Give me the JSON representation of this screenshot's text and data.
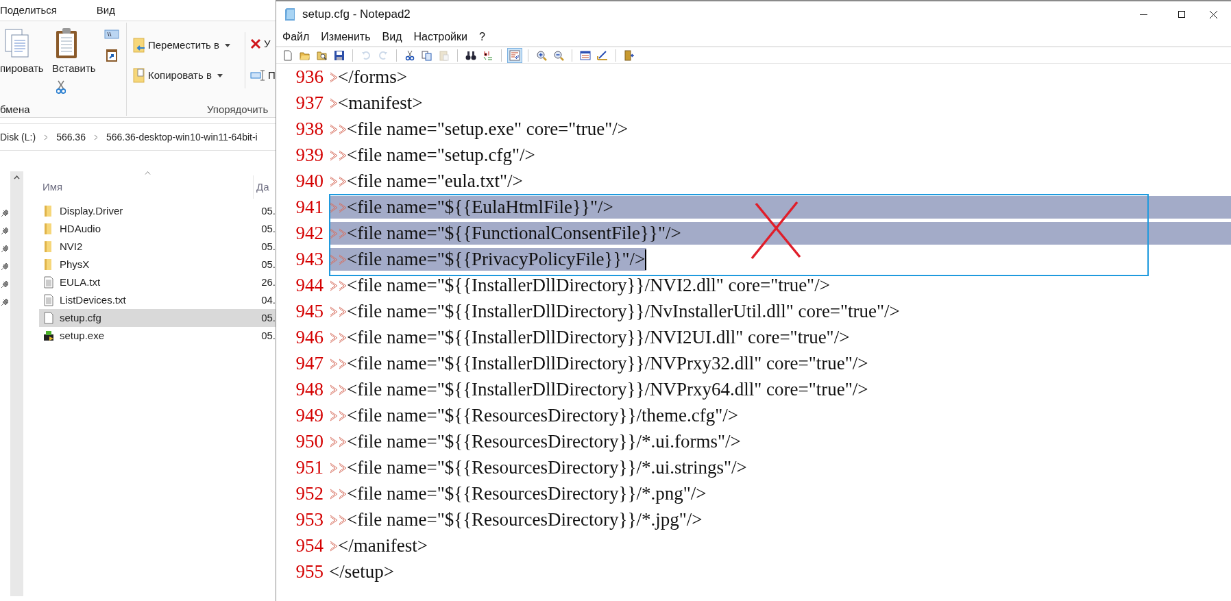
{
  "explorer": {
    "ribbon_tabs": [
      {
        "label": "Поделиться"
      },
      {
        "label": "Вид"
      }
    ],
    "clipboard": {
      "copy_label": "пировать",
      "paste_label": "Вставить",
      "group_label": "бмена"
    },
    "organize": {
      "move_label": "Переместить в",
      "copy_to_label": "Копировать в",
      "delete_label": "У",
      "rename_label": "П",
      "group_label": "Упорядочить"
    },
    "path": [
      "Disk (L:)",
      "566.36",
      "566.36-desktop-win10-win11-64bit-i"
    ],
    "columns": [
      "Имя",
      "Да"
    ],
    "files": [
      {
        "kind": "folder",
        "name": "Display.Driver",
        "date": "05.",
        "selected": false
      },
      {
        "kind": "folder",
        "name": "HDAudio",
        "date": "05.",
        "selected": false
      },
      {
        "kind": "folder",
        "name": "NVI2",
        "date": "05.",
        "selected": false
      },
      {
        "kind": "folder",
        "name": "PhysX",
        "date": "05.",
        "selected": false
      },
      {
        "kind": "text",
        "name": "EULA.txt",
        "date": "26.",
        "selected": false
      },
      {
        "kind": "text",
        "name": "ListDevices.txt",
        "date": "04.",
        "selected": false
      },
      {
        "kind": "blank",
        "name": "setup.cfg",
        "date": "05.",
        "selected": true
      },
      {
        "kind": "exe",
        "name": "setup.exe",
        "date": "05.",
        "selected": false
      }
    ]
  },
  "notepad": {
    "title": "setup.cfg - Notepad2",
    "menu": [
      "Файл",
      "Изменить",
      "Вид",
      "Настройки",
      "?"
    ],
    "toolbar": [
      {
        "kind": "new",
        "pressed": false,
        "disabled": false
      },
      {
        "kind": "open",
        "pressed": false,
        "disabled": false
      },
      {
        "kind": "browse",
        "pressed": false,
        "disabled": false
      },
      {
        "kind": "save",
        "pressed": false,
        "disabled": false
      },
      {
        "kind": "sep"
      },
      {
        "kind": "undo",
        "pressed": false,
        "disabled": true
      },
      {
        "kind": "redo",
        "pressed": false,
        "disabled": true
      },
      {
        "kind": "sep"
      },
      {
        "kind": "cut",
        "pressed": false,
        "disabled": false
      },
      {
        "kind": "copy",
        "pressed": false,
        "disabled": false
      },
      {
        "kind": "paste",
        "pressed": false,
        "disabled": true
      },
      {
        "kind": "sep"
      },
      {
        "kind": "find",
        "pressed": false,
        "disabled": false
      },
      {
        "kind": "replace",
        "pressed": false,
        "disabled": false
      },
      {
        "kind": "sep"
      },
      {
        "kind": "wrap",
        "pressed": true,
        "disabled": false
      },
      {
        "kind": "sep"
      },
      {
        "kind": "zoomin",
        "pressed": false,
        "disabled": false
      },
      {
        "kind": "zoomout",
        "pressed": false,
        "disabled": false
      },
      {
        "kind": "sep"
      },
      {
        "kind": "scheme",
        "pressed": false,
        "disabled": false
      },
      {
        "kind": "customize",
        "pressed": false,
        "disabled": false
      },
      {
        "kind": "sep"
      },
      {
        "kind": "exit",
        "pressed": false,
        "disabled": false
      }
    ],
    "lines": [
      {
        "number": "936",
        "kind": "tab1",
        "text": "</forms>",
        "selected": false,
        "caret": false
      },
      {
        "number": "937",
        "kind": "tab1",
        "text": "<manifest>",
        "selected": false,
        "caret": false
      },
      {
        "number": "938",
        "kind": "tab2",
        "text": "<file name=\"setup.exe\" core=\"true\"/>",
        "selected": false,
        "caret": false
      },
      {
        "number": "939",
        "kind": "tab2",
        "text": "<file name=\"setup.cfg\"/>",
        "selected": false,
        "caret": false
      },
      {
        "number": "940",
        "kind": "tab2",
        "text": "<file name=\"eula.txt\"/>",
        "selected": false,
        "caret": false
      },
      {
        "number": "941",
        "kind": "tab2",
        "text": "<file name=\"${{EulaHtmlFile}}\"/>",
        "selected": true,
        "caret": false
      },
      {
        "number": "942",
        "kind": "tab2",
        "text": "<file name=\"${{FunctionalConsentFile}}\"/>",
        "selected": true,
        "caret": false
      },
      {
        "number": "943",
        "kind": "tab2",
        "text": "<file name=\"${{PrivacyPolicyFile}}\"/>",
        "selected": true,
        "caret": true
      },
      {
        "number": "944",
        "kind": "tab2",
        "text": "<file name=\"${{InstallerDllDirectory}}/NVI2.dll\" core=\"true\"/>",
        "selected": false,
        "caret": false
      },
      {
        "number": "945",
        "kind": "tab2",
        "text": "<file name=\"${{InstallerDllDirectory}}/NvInstallerUtil.dll\" core=\"true\"/>",
        "selected": false,
        "caret": false
      },
      {
        "number": "946",
        "kind": "tab2",
        "text": "<file name=\"${{InstallerDllDirectory}}/NVI2UI.dll\" core=\"true\"/>",
        "selected": false,
        "caret": false
      },
      {
        "number": "947",
        "kind": "tab2",
        "text": "<file name=\"${{InstallerDllDirectory}}/NVPrxy32.dll\" core=\"true\"/>",
        "selected": false,
        "caret": false
      },
      {
        "number": "948",
        "kind": "tab2",
        "text": "<file name=\"${{InstallerDllDirectory}}/NVPrxy64.dll\" core=\"true\"/>",
        "selected": false,
        "caret": false
      },
      {
        "number": "949",
        "kind": "tab2",
        "text": "<file name=\"${{ResourcesDirectory}}/theme.cfg\"/>",
        "selected": false,
        "caret": false
      },
      {
        "number": "950",
        "kind": "tab2",
        "text": "<file name=\"${{ResourcesDirectory}}/*.ui.forms\"/>",
        "selected": false,
        "caret": false
      },
      {
        "number": "951",
        "kind": "tab2",
        "text": "<file name=\"${{ResourcesDirectory}}/*.ui.strings\"/>",
        "selected": false,
        "caret": false
      },
      {
        "number": "952",
        "kind": "tab2",
        "text": "<file name=\"${{ResourcesDirectory}}/*.png\"/>",
        "selected": false,
        "caret": false
      },
      {
        "number": "953",
        "kind": "tab2",
        "text": "<file name=\"${{ResourcesDirectory}}/*.jpg\"/>",
        "selected": false,
        "caret": false
      },
      {
        "number": "954",
        "kind": "tab1",
        "text": "</manifest>",
        "selected": false,
        "caret": false
      },
      {
        "number": "955",
        "kind": "none",
        "text": "</setup>",
        "selected": false,
        "caret": false
      }
    ],
    "annotations": {
      "frame": true,
      "cross": true
    }
  }
}
